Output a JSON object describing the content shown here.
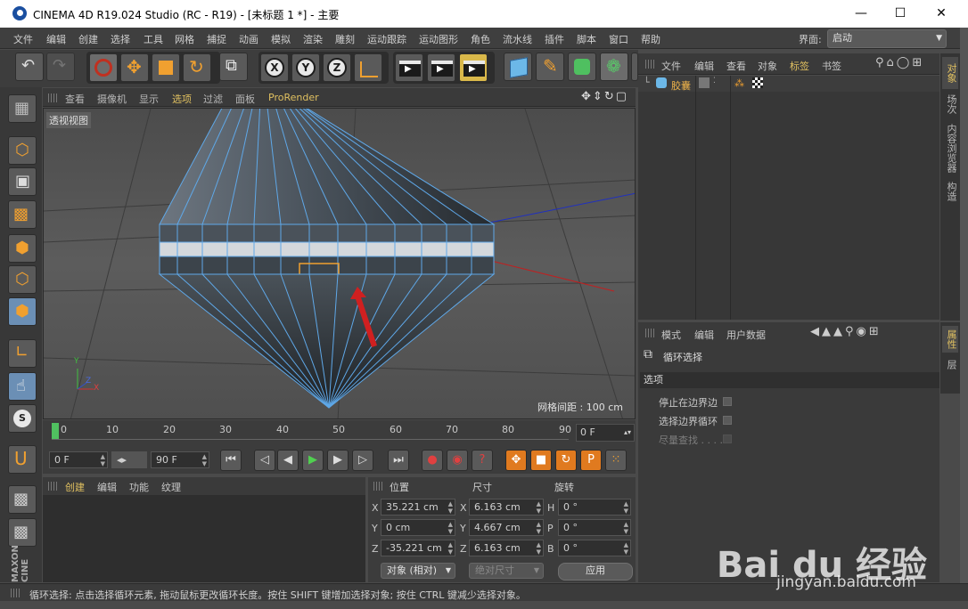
{
  "window": {
    "title": "CINEMA 4D R19.024 Studio (RC - R19) - [未标题 1 *] - 主要",
    "minimize": "—",
    "maximize": "☐",
    "close": "✕"
  },
  "menu": [
    "文件",
    "编辑",
    "创建",
    "选择",
    "工具",
    "网格",
    "捕捉",
    "动画",
    "模拟",
    "渲染",
    "雕刻",
    "运动跟踪",
    "运动图形",
    "角色",
    "流水线",
    "插件",
    "脚本",
    "窗口",
    "帮助"
  ],
  "layout": {
    "label": "界面:",
    "value": "启动"
  },
  "viewport": {
    "menu": [
      "查看",
      "摄像机",
      "显示",
      "选项",
      "过滤",
      "面板",
      "ProRender"
    ],
    "label": "透视视图",
    "grid_info": "网格间距 : 100 cm",
    "axis_y": "Y",
    "axis_z": "Z",
    "axis_x": "X"
  },
  "timeline": {
    "ticks": [
      "0",
      "10",
      "20",
      "30",
      "40",
      "50",
      "60",
      "70",
      "80",
      "90"
    ],
    "frame_field": "0 F"
  },
  "controls": {
    "start": "0 F",
    "end": "90 F"
  },
  "material": {
    "menu": [
      "创建",
      "编辑",
      "功能",
      "纹理"
    ]
  },
  "coordinates": {
    "headers": {
      "position": "位置",
      "size": "尺寸",
      "rotation": "旋转"
    },
    "rows": [
      {
        "axis": "X",
        "pos": "35.221 cm",
        "size_axis": "X",
        "size": "6.163 cm",
        "rot_axis": "H",
        "rot": "0 °"
      },
      {
        "axis": "Y",
        "pos": "0 cm",
        "size_axis": "Y",
        "size": "4.667 cm",
        "rot_axis": "P",
        "rot": "0 °"
      },
      {
        "axis": "Z",
        "pos": "-35.221 cm",
        "size_axis": "Z",
        "size": "6.163 cm",
        "rot_axis": "B",
        "rot": "0 °"
      }
    ],
    "mode": "对象 (相对)",
    "size_mode": "绝对尺寸",
    "apply": "应用"
  },
  "status": "循环选择: 点击选择循环元素, 拖动鼠标更改循环长度。按住 SHIFT 键增加选择对象; 按住 CTRL 键减少选择对象。",
  "objects": {
    "menu": [
      "文件",
      "编辑",
      "查看",
      "对象",
      "标签",
      "书签"
    ],
    "items": [
      {
        "name": "胶囊"
      }
    ]
  },
  "attributes": {
    "menu": [
      "模式",
      "编辑",
      "用户数据"
    ],
    "tool_name": "循环选择",
    "section": "选项",
    "options": [
      {
        "label": "停止在边界边"
      },
      {
        "label": "选择边界循环"
      },
      {
        "label": "尽量查找 . . . ."
      }
    ]
  },
  "right_tabs": [
    "对象",
    "场次",
    "内容浏览器",
    "构造"
  ],
  "right_tabs2": [
    "属性",
    "层"
  ],
  "watermark": {
    "main": "Bai du 经验",
    "sub": "jingyan.baidu.com"
  }
}
